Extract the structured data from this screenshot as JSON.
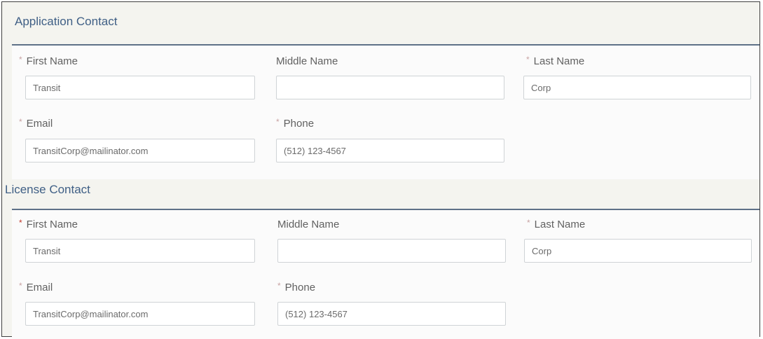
{
  "application_contact": {
    "title": "Application Contact",
    "first_name": {
      "label": "First Name",
      "value": "Transit"
    },
    "middle_name": {
      "label": "Middle Name",
      "value": ""
    },
    "last_name": {
      "label": "Last Name",
      "value": "Corp"
    },
    "email": {
      "label": "Email",
      "value": "TransitCorp@mailinator.com"
    },
    "phone": {
      "label": "Phone",
      "value": "(512) 123-4567"
    }
  },
  "license_contact": {
    "title": "License Contact",
    "first_name": {
      "label": "First Name",
      "value": "Transit"
    },
    "middle_name": {
      "label": "Middle Name",
      "value": ""
    },
    "last_name": {
      "label": "Last Name",
      "value": "Corp"
    },
    "email": {
      "label": "Email",
      "value": "TransitCorp@mailinator.com"
    },
    "phone": {
      "label": "Phone",
      "value": "(512) 123-4567"
    }
  },
  "required_marker": "*",
  "colors": {
    "heading": "#3f5f85",
    "required": "#c0392b",
    "divider": "#5e7187"
  }
}
